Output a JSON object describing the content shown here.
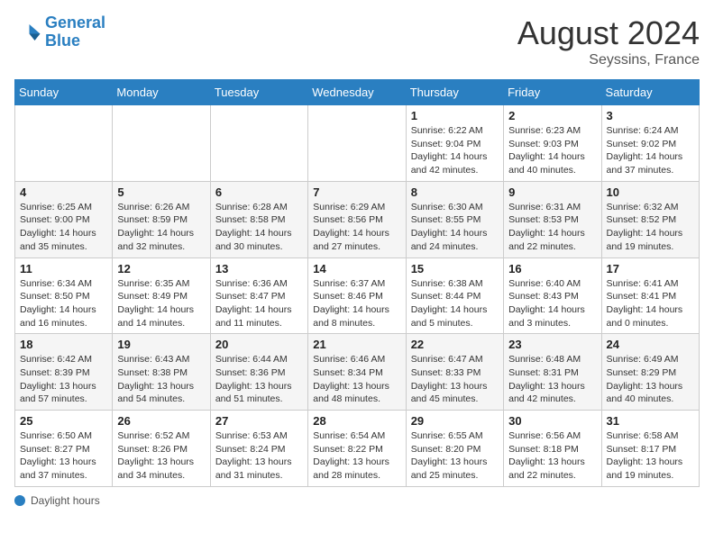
{
  "header": {
    "logo_line1": "General",
    "logo_line2": "Blue",
    "main_title": "August 2024",
    "subtitle": "Seyssins, France"
  },
  "weekdays": [
    "Sunday",
    "Monday",
    "Tuesday",
    "Wednesday",
    "Thursday",
    "Friday",
    "Saturday"
  ],
  "footer": {
    "label": "Daylight hours"
  },
  "weeks": [
    [
      {
        "day": "",
        "info": ""
      },
      {
        "day": "",
        "info": ""
      },
      {
        "day": "",
        "info": ""
      },
      {
        "day": "",
        "info": ""
      },
      {
        "day": "1",
        "info": "Sunrise: 6:22 AM\nSunset: 9:04 PM\nDaylight: 14 hours\nand 42 minutes."
      },
      {
        "day": "2",
        "info": "Sunrise: 6:23 AM\nSunset: 9:03 PM\nDaylight: 14 hours\nand 40 minutes."
      },
      {
        "day": "3",
        "info": "Sunrise: 6:24 AM\nSunset: 9:02 PM\nDaylight: 14 hours\nand 37 minutes."
      }
    ],
    [
      {
        "day": "4",
        "info": "Sunrise: 6:25 AM\nSunset: 9:00 PM\nDaylight: 14 hours\nand 35 minutes."
      },
      {
        "day": "5",
        "info": "Sunrise: 6:26 AM\nSunset: 8:59 PM\nDaylight: 14 hours\nand 32 minutes."
      },
      {
        "day": "6",
        "info": "Sunrise: 6:28 AM\nSunset: 8:58 PM\nDaylight: 14 hours\nand 30 minutes."
      },
      {
        "day": "7",
        "info": "Sunrise: 6:29 AM\nSunset: 8:56 PM\nDaylight: 14 hours\nand 27 minutes."
      },
      {
        "day": "8",
        "info": "Sunrise: 6:30 AM\nSunset: 8:55 PM\nDaylight: 14 hours\nand 24 minutes."
      },
      {
        "day": "9",
        "info": "Sunrise: 6:31 AM\nSunset: 8:53 PM\nDaylight: 14 hours\nand 22 minutes."
      },
      {
        "day": "10",
        "info": "Sunrise: 6:32 AM\nSunset: 8:52 PM\nDaylight: 14 hours\nand 19 minutes."
      }
    ],
    [
      {
        "day": "11",
        "info": "Sunrise: 6:34 AM\nSunset: 8:50 PM\nDaylight: 14 hours\nand 16 minutes."
      },
      {
        "day": "12",
        "info": "Sunrise: 6:35 AM\nSunset: 8:49 PM\nDaylight: 14 hours\nand 14 minutes."
      },
      {
        "day": "13",
        "info": "Sunrise: 6:36 AM\nSunset: 8:47 PM\nDaylight: 14 hours\nand 11 minutes."
      },
      {
        "day": "14",
        "info": "Sunrise: 6:37 AM\nSunset: 8:46 PM\nDaylight: 14 hours\nand 8 minutes."
      },
      {
        "day": "15",
        "info": "Sunrise: 6:38 AM\nSunset: 8:44 PM\nDaylight: 14 hours\nand 5 minutes."
      },
      {
        "day": "16",
        "info": "Sunrise: 6:40 AM\nSunset: 8:43 PM\nDaylight: 14 hours\nand 3 minutes."
      },
      {
        "day": "17",
        "info": "Sunrise: 6:41 AM\nSunset: 8:41 PM\nDaylight: 14 hours\nand 0 minutes."
      }
    ],
    [
      {
        "day": "18",
        "info": "Sunrise: 6:42 AM\nSunset: 8:39 PM\nDaylight: 13 hours\nand 57 minutes."
      },
      {
        "day": "19",
        "info": "Sunrise: 6:43 AM\nSunset: 8:38 PM\nDaylight: 13 hours\nand 54 minutes."
      },
      {
        "day": "20",
        "info": "Sunrise: 6:44 AM\nSunset: 8:36 PM\nDaylight: 13 hours\nand 51 minutes."
      },
      {
        "day": "21",
        "info": "Sunrise: 6:46 AM\nSunset: 8:34 PM\nDaylight: 13 hours\nand 48 minutes."
      },
      {
        "day": "22",
        "info": "Sunrise: 6:47 AM\nSunset: 8:33 PM\nDaylight: 13 hours\nand 45 minutes."
      },
      {
        "day": "23",
        "info": "Sunrise: 6:48 AM\nSunset: 8:31 PM\nDaylight: 13 hours\nand 42 minutes."
      },
      {
        "day": "24",
        "info": "Sunrise: 6:49 AM\nSunset: 8:29 PM\nDaylight: 13 hours\nand 40 minutes."
      }
    ],
    [
      {
        "day": "25",
        "info": "Sunrise: 6:50 AM\nSunset: 8:27 PM\nDaylight: 13 hours\nand 37 minutes."
      },
      {
        "day": "26",
        "info": "Sunrise: 6:52 AM\nSunset: 8:26 PM\nDaylight: 13 hours\nand 34 minutes."
      },
      {
        "day": "27",
        "info": "Sunrise: 6:53 AM\nSunset: 8:24 PM\nDaylight: 13 hours\nand 31 minutes."
      },
      {
        "day": "28",
        "info": "Sunrise: 6:54 AM\nSunset: 8:22 PM\nDaylight: 13 hours\nand 28 minutes."
      },
      {
        "day": "29",
        "info": "Sunrise: 6:55 AM\nSunset: 8:20 PM\nDaylight: 13 hours\nand 25 minutes."
      },
      {
        "day": "30",
        "info": "Sunrise: 6:56 AM\nSunset: 8:18 PM\nDaylight: 13 hours\nand 22 minutes."
      },
      {
        "day": "31",
        "info": "Sunrise: 6:58 AM\nSunset: 8:17 PM\nDaylight: 13 hours\nand 19 minutes."
      }
    ]
  ]
}
